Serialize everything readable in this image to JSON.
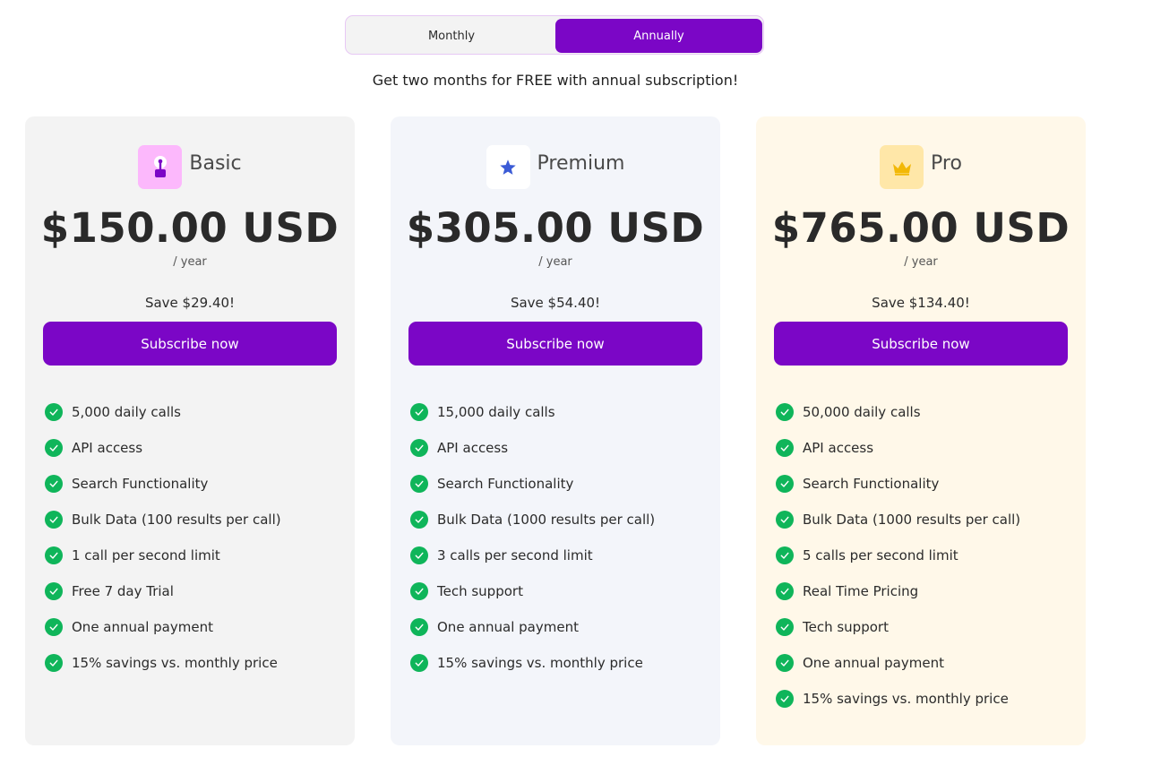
{
  "billing_toggle": {
    "options": [
      "Monthly",
      "Annually"
    ],
    "selected": "Annually"
  },
  "promo_text": "Get two months for FREE with annual subscription!",
  "colors": {
    "accent": "#7b06c6",
    "check": "#0fb55a",
    "basic_card_bg": "#f3f3f3",
    "premium_card_bg": "#f3f5fa",
    "pro_card_bg": "#fff8e9"
  },
  "plans": [
    {
      "name": "Basic",
      "icon": "joystick-icon",
      "price": "$150.00 USD",
      "period": "/ year",
      "savings": "Save $29.40!",
      "cta": "Subscribe now",
      "features": [
        "5,000 daily calls",
        "API access",
        "Search Functionality",
        "Bulk Data (100 results per call)",
        "1 call per second limit",
        "Free 7 day Trial",
        "One annual payment",
        "15% savings vs. monthly price"
      ]
    },
    {
      "name": "Premium",
      "icon": "star-icon",
      "price": "$305.00 USD",
      "period": "/ year",
      "savings": "Save $54.40!",
      "cta": "Subscribe now",
      "features": [
        "15,000 daily calls",
        "API access",
        "Search Functionality",
        "Bulk Data (1000 results per call)",
        "3 calls per second limit",
        "Tech support",
        "One annual payment",
        "15% savings vs. monthly price"
      ]
    },
    {
      "name": "Pro",
      "icon": "crown-icon",
      "price": "$765.00 USD",
      "period": "/ year",
      "savings": "Save $134.40!",
      "cta": "Subscribe now",
      "features": [
        "50,000 daily calls",
        "API access",
        "Search Functionality",
        "Bulk Data (1000 results per call)",
        "5 calls per second limit",
        "Real Time Pricing",
        "Tech support",
        "One annual payment",
        "15% savings vs. monthly price"
      ]
    }
  ]
}
